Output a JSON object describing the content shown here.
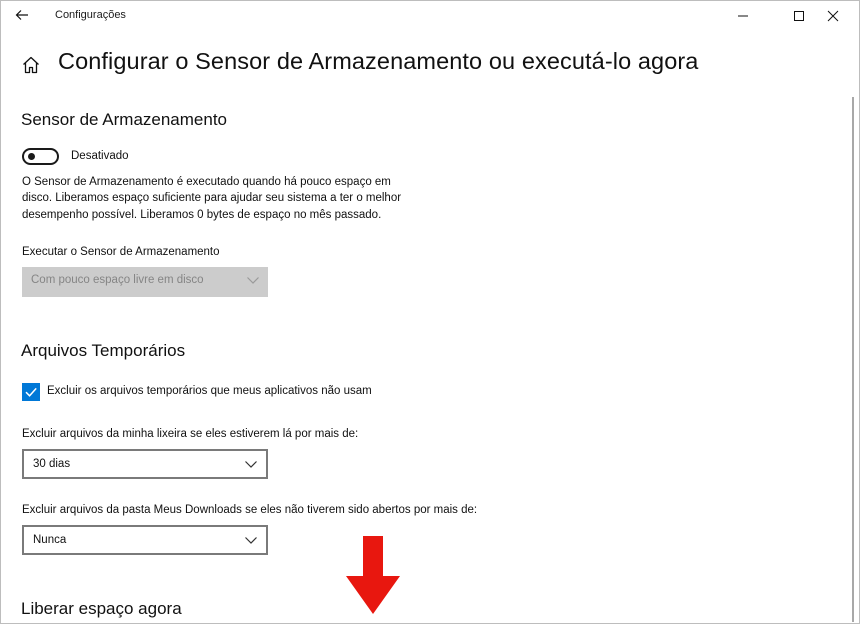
{
  "window": {
    "title": "Configurações",
    "back_icon": "back-arrow-icon",
    "minimize_icon": "minimize-icon",
    "maximize_icon": "maximize-icon",
    "close_icon": "close-icon"
  },
  "page": {
    "home_icon": "home-icon",
    "title": "Configurar o Sensor de Armazenamento ou executá-lo agora"
  },
  "storage_sense": {
    "heading": "Sensor de Armazenamento",
    "toggle_state": "Desativado",
    "toggle_on": false,
    "description": "O Sensor de Armazenamento é executado quando há pouco espaço em disco. Liberamos espaço suficiente para ajudar seu sistema a ter o melhor desempenho possível. Liberamos 0 bytes de espaço no mês passado.",
    "run_label": "Executar o Sensor de Armazenamento",
    "run_value": "Com pouco espaço livre em disco"
  },
  "temp_files": {
    "heading": "Arquivos Temporários",
    "checkbox_label": "Excluir os arquivos temporários que meus aplicativos não usam",
    "checkbox_checked": true,
    "recycle_label": "Excluir arquivos da minha lixeira se eles estiverem lá por mais de:",
    "recycle_value": "30 dias",
    "downloads_label": "Excluir arquivos da pasta Meus Downloads se eles não tiverem sido abertos por mais de:",
    "downloads_value": "Nunca"
  },
  "free_now": {
    "heading": "Liberar espaço agora"
  },
  "colors": {
    "accent": "#0078d7",
    "annotation_arrow": "#e8170f",
    "disabled_bg": "#cccccc"
  }
}
